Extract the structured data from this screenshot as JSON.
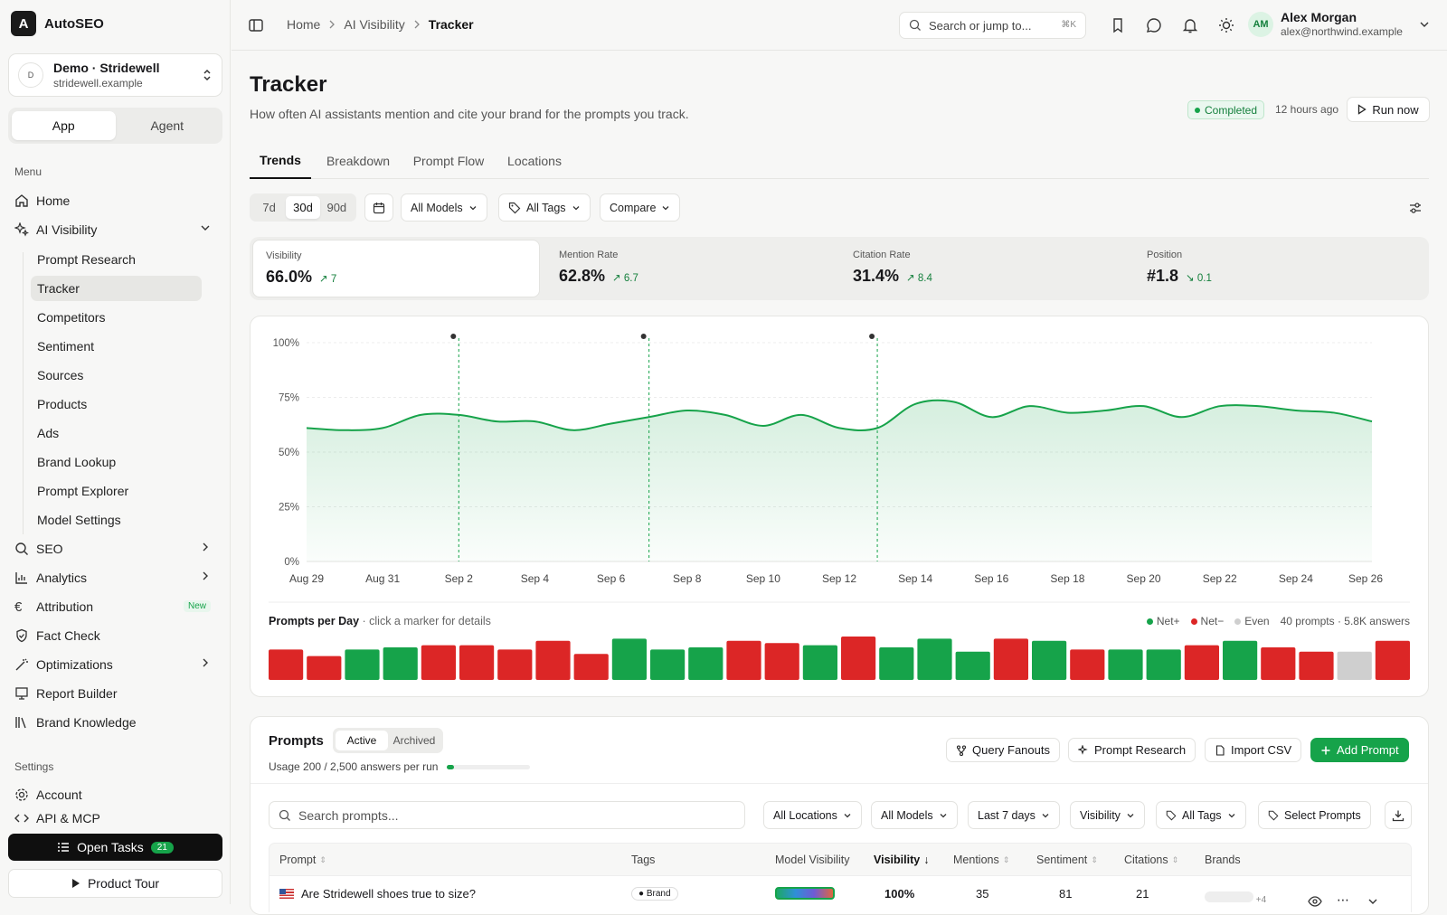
{
  "app": {
    "name": "AutoSEO"
  },
  "workspace": {
    "avatar": "D",
    "name": "Demo · Stridewell",
    "domain": "stridewell.example"
  },
  "mode": {
    "app": "App",
    "agent": "Agent"
  },
  "sidebar": {
    "menu_label": "Menu",
    "settings_label": "Settings",
    "items": [
      "Home",
      "AI Visibility",
      "SEO",
      "Analytics",
      "Attribution",
      "Fact Check",
      "Optimizations",
      "Report Builder",
      "Brand Knowledge"
    ],
    "new_badge": "New",
    "sub_items": [
      "Prompt Research",
      "Tracker",
      "Competitors",
      "Sentiment",
      "Sources",
      "Products",
      "Ads",
      "Brand Lookup",
      "Prompt Explorer",
      "Model Settings"
    ],
    "settings_items": [
      "Account",
      "API & MCP"
    ],
    "open_tasks": "Open Tasks",
    "open_tasks_count": "21",
    "product_tour": "Product Tour"
  },
  "topbar": {
    "crumbs": [
      "Home",
      "AI Visibility",
      "Tracker"
    ],
    "search_placeholder": "Search or jump to...",
    "search_kbd": "⌘K",
    "user": {
      "initials": "AM",
      "name": "Alex Morgan",
      "email": "alex@northwind.example"
    }
  },
  "page": {
    "title": "Tracker",
    "subtitle": "How often AI assistants mention and cite your brand for the prompts you track.",
    "status": "Completed",
    "ago": "12 hours ago",
    "run_now": "Run now"
  },
  "tabs": [
    "Trends",
    "Breakdown",
    "Prompt Flow",
    "Locations"
  ],
  "filters": {
    "ranges": [
      "7d",
      "30d",
      "90d"
    ],
    "models": "All Models",
    "tags": "All Tags",
    "compare": "Compare"
  },
  "metrics": [
    {
      "label": "Visibility",
      "value": "66.0%",
      "delta": "7",
      "dir": "up"
    },
    {
      "label": "Mention Rate",
      "value": "62.8%",
      "delta": "6.7",
      "dir": "up"
    },
    {
      "label": "Citation Rate",
      "value": "31.4%",
      "delta": "8.4",
      "dir": "up"
    },
    {
      "label": "Position",
      "value": "#1.8",
      "delta": "0.1",
      "dir": "down"
    }
  ],
  "colors": {
    "accent": "#16a34a",
    "negative": "#dc2626",
    "even": "#cfcfcf"
  },
  "chart_data": [
    {
      "type": "area",
      "title": "",
      "ylabel": "",
      "xlabel": "",
      "ylim": [
        0,
        100
      ],
      "yticks": [
        "0%",
        "25%",
        "50%",
        "75%",
        "100%"
      ],
      "xticks": [
        "Aug 29",
        "Aug 31",
        "Sep 2",
        "Sep 4",
        "Sep 6",
        "Sep 8",
        "Sep 10",
        "Sep 12",
        "Sep 14",
        "Sep 16",
        "Sep 18",
        "Sep 20",
        "Sep 22",
        "Sep 24",
        "Sep 26"
      ],
      "x": [
        "Aug 29",
        "Aug 30",
        "Aug 31",
        "Sep 1",
        "Sep 2",
        "Sep 3",
        "Sep 4",
        "Sep 5",
        "Sep 6",
        "Sep 7",
        "Sep 8",
        "Sep 9",
        "Sep 10",
        "Sep 11",
        "Sep 12",
        "Sep 13",
        "Sep 14",
        "Sep 15",
        "Sep 16",
        "Sep 17",
        "Sep 18",
        "Sep 19",
        "Sep 20",
        "Sep 21",
        "Sep 22",
        "Sep 23",
        "Sep 24",
        "Sep 25",
        "Sep 26"
      ],
      "values": [
        61,
        60,
        61,
        67,
        67,
        64,
        64,
        60,
        63,
        66,
        69,
        67,
        62,
        67,
        61,
        61,
        72,
        73,
        66,
        71,
        68,
        69,
        71,
        66,
        71,
        71,
        69,
        68,
        64
      ],
      "markers": [
        "Sep 2",
        "Sep 7",
        "Sep 13"
      ],
      "grid": true
    },
    {
      "type": "bar",
      "title": "Prompts per Day",
      "subtitle": "· click a marker for details",
      "legend": [
        "Net+",
        "Net−",
        "Even"
      ],
      "summary": "40 prompts · 5.8K answers",
      "values": [
        14,
        11,
        14,
        15,
        16,
        16,
        14,
        18,
        12,
        19,
        14,
        15,
        18,
        17,
        16,
        20,
        15,
        19,
        13,
        19,
        18,
        14,
        14,
        14,
        16,
        18,
        15,
        13,
        13,
        18
      ],
      "status": [
        "neg",
        "neg",
        "pos",
        "pos",
        "neg",
        "neg",
        "neg",
        "neg",
        "neg",
        "pos",
        "pos",
        "pos",
        "neg",
        "neg",
        "pos",
        "neg",
        "pos",
        "pos",
        "pos",
        "neg",
        "pos",
        "neg",
        "pos",
        "pos",
        "neg",
        "pos",
        "neg",
        "neg",
        "even",
        "neg"
      ]
    }
  ],
  "prompts": {
    "title": "Prompts",
    "tabs": [
      "Active",
      "Archived"
    ],
    "usage": "Usage 200 / 2,500 answers per run",
    "usage_fraction": 0.08,
    "actions": [
      "Query Fanouts",
      "Prompt Research",
      "Import CSV",
      "Add Prompt"
    ],
    "search_placeholder": "Search prompts...",
    "filters": [
      "All Locations",
      "All Models",
      "Last 7 days",
      "Visibility",
      "All Tags",
      "Select Prompts"
    ],
    "columns": [
      "Prompt",
      "Tags",
      "Model Visibility",
      "Visibility",
      "Mentions",
      "Sentiment",
      "Citations",
      "Brands"
    ],
    "rows": [
      {
        "prompt": "Are Stridewell shoes true to size?",
        "tag": "Brand",
        "visibility": "100%",
        "mentions": "35",
        "sentiment": "81",
        "citations": "21",
        "brands_more": "+4"
      }
    ]
  }
}
